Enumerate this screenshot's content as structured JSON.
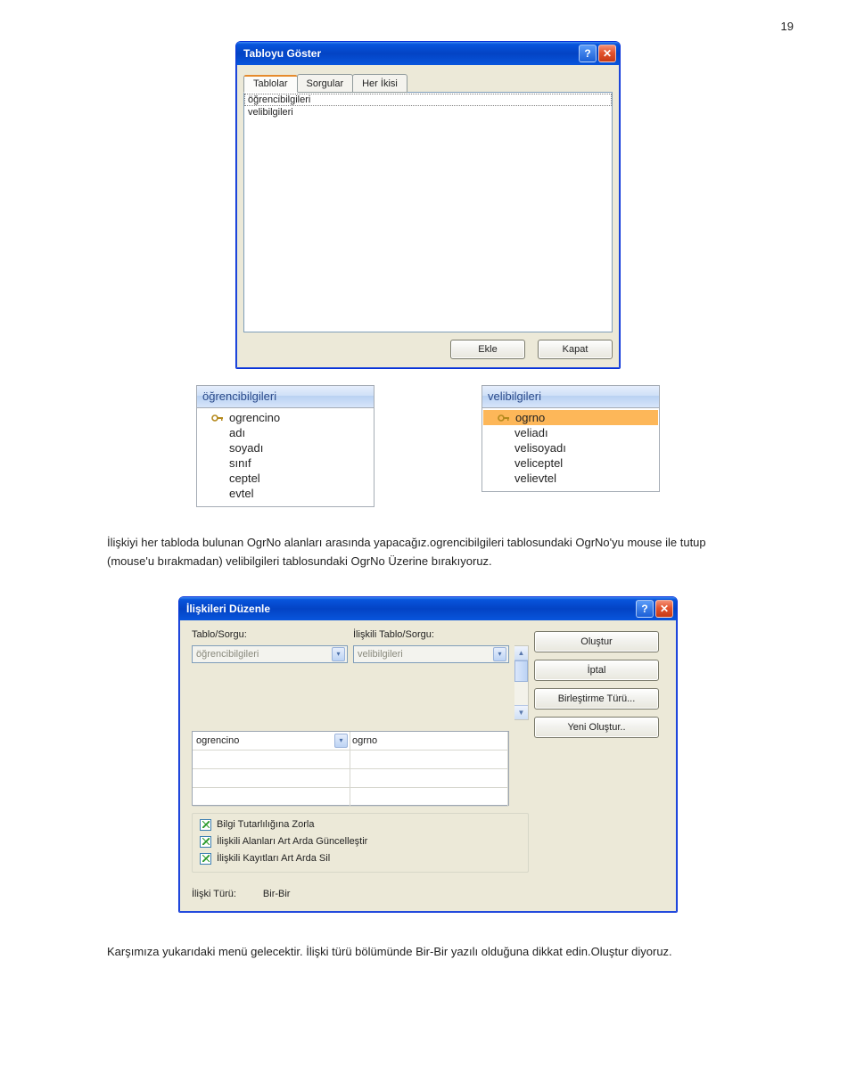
{
  "page_number": "19",
  "show_table_dialog": {
    "title": "Tabloyu Göster",
    "tabs": [
      "Tablolar",
      "Sorgular",
      "Her İkisi"
    ],
    "active_tab": 0,
    "list_items": [
      "öğrencibilgileri",
      "velibilgileri"
    ],
    "selected_index": 0,
    "buttons": {
      "add": "Ekle",
      "close": "Kapat"
    }
  },
  "field_lists": {
    "left": {
      "title": "öğrencibilgileri",
      "fields": [
        {
          "name": "ogrencino",
          "key": true
        },
        {
          "name": "adı"
        },
        {
          "name": "soyadı"
        },
        {
          "name": "sınıf"
        },
        {
          "name": "ceptel"
        },
        {
          "name": "evtel"
        }
      ]
    },
    "right": {
      "title": "velibilgileri",
      "selected_index": 0,
      "fields": [
        {
          "name": "ogrno",
          "key": true
        },
        {
          "name": "veliadı"
        },
        {
          "name": "velisoyadı"
        },
        {
          "name": "veliceptel"
        },
        {
          "name": "velievtel"
        }
      ]
    }
  },
  "paragraph1": "İlişkiyi her tabloda bulunan OgrNo alanları arasında yapacağız.ogrencibilgileri tablosundaki OgrNo'yu mouse ile tutup (mouse'u bırakmadan) velibilgileri tablosundaki OgrNo Üzerine bırakıyoruz.",
  "edit_rel_dialog": {
    "title": "İlişkileri Düzenle",
    "labels": {
      "table": "Tablo/Sorgu:",
      "related_table": "İlişkili Tablo/Sorgu:",
      "rel_type": "İlişki Türü:"
    },
    "table_combo": "öğrencibilgileri",
    "related_combo": "velibilgileri",
    "left_field": "ogrencino",
    "right_field": "ogrno",
    "buttons": {
      "create": "Oluştur",
      "cancel": "İptal",
      "join_type": "Birleştirme Türü...",
      "new": "Yeni Oluştur.."
    },
    "checkboxes": {
      "ref_integrity": "Bilgi Tutarlılığına Zorla",
      "cascade_update": "İlişkili Alanları Art Arda Güncelleştir",
      "cascade_delete": "İlişkili Kayıtları Art Arda Sil"
    },
    "rel_type_value": "Bir-Bir"
  },
  "paragraph2": "Karşımıza yukarıdaki menü gelecektir. İlişki türü bölümünde Bir-Bir yazılı olduğuna dikkat edin.Oluştur diyoruz."
}
